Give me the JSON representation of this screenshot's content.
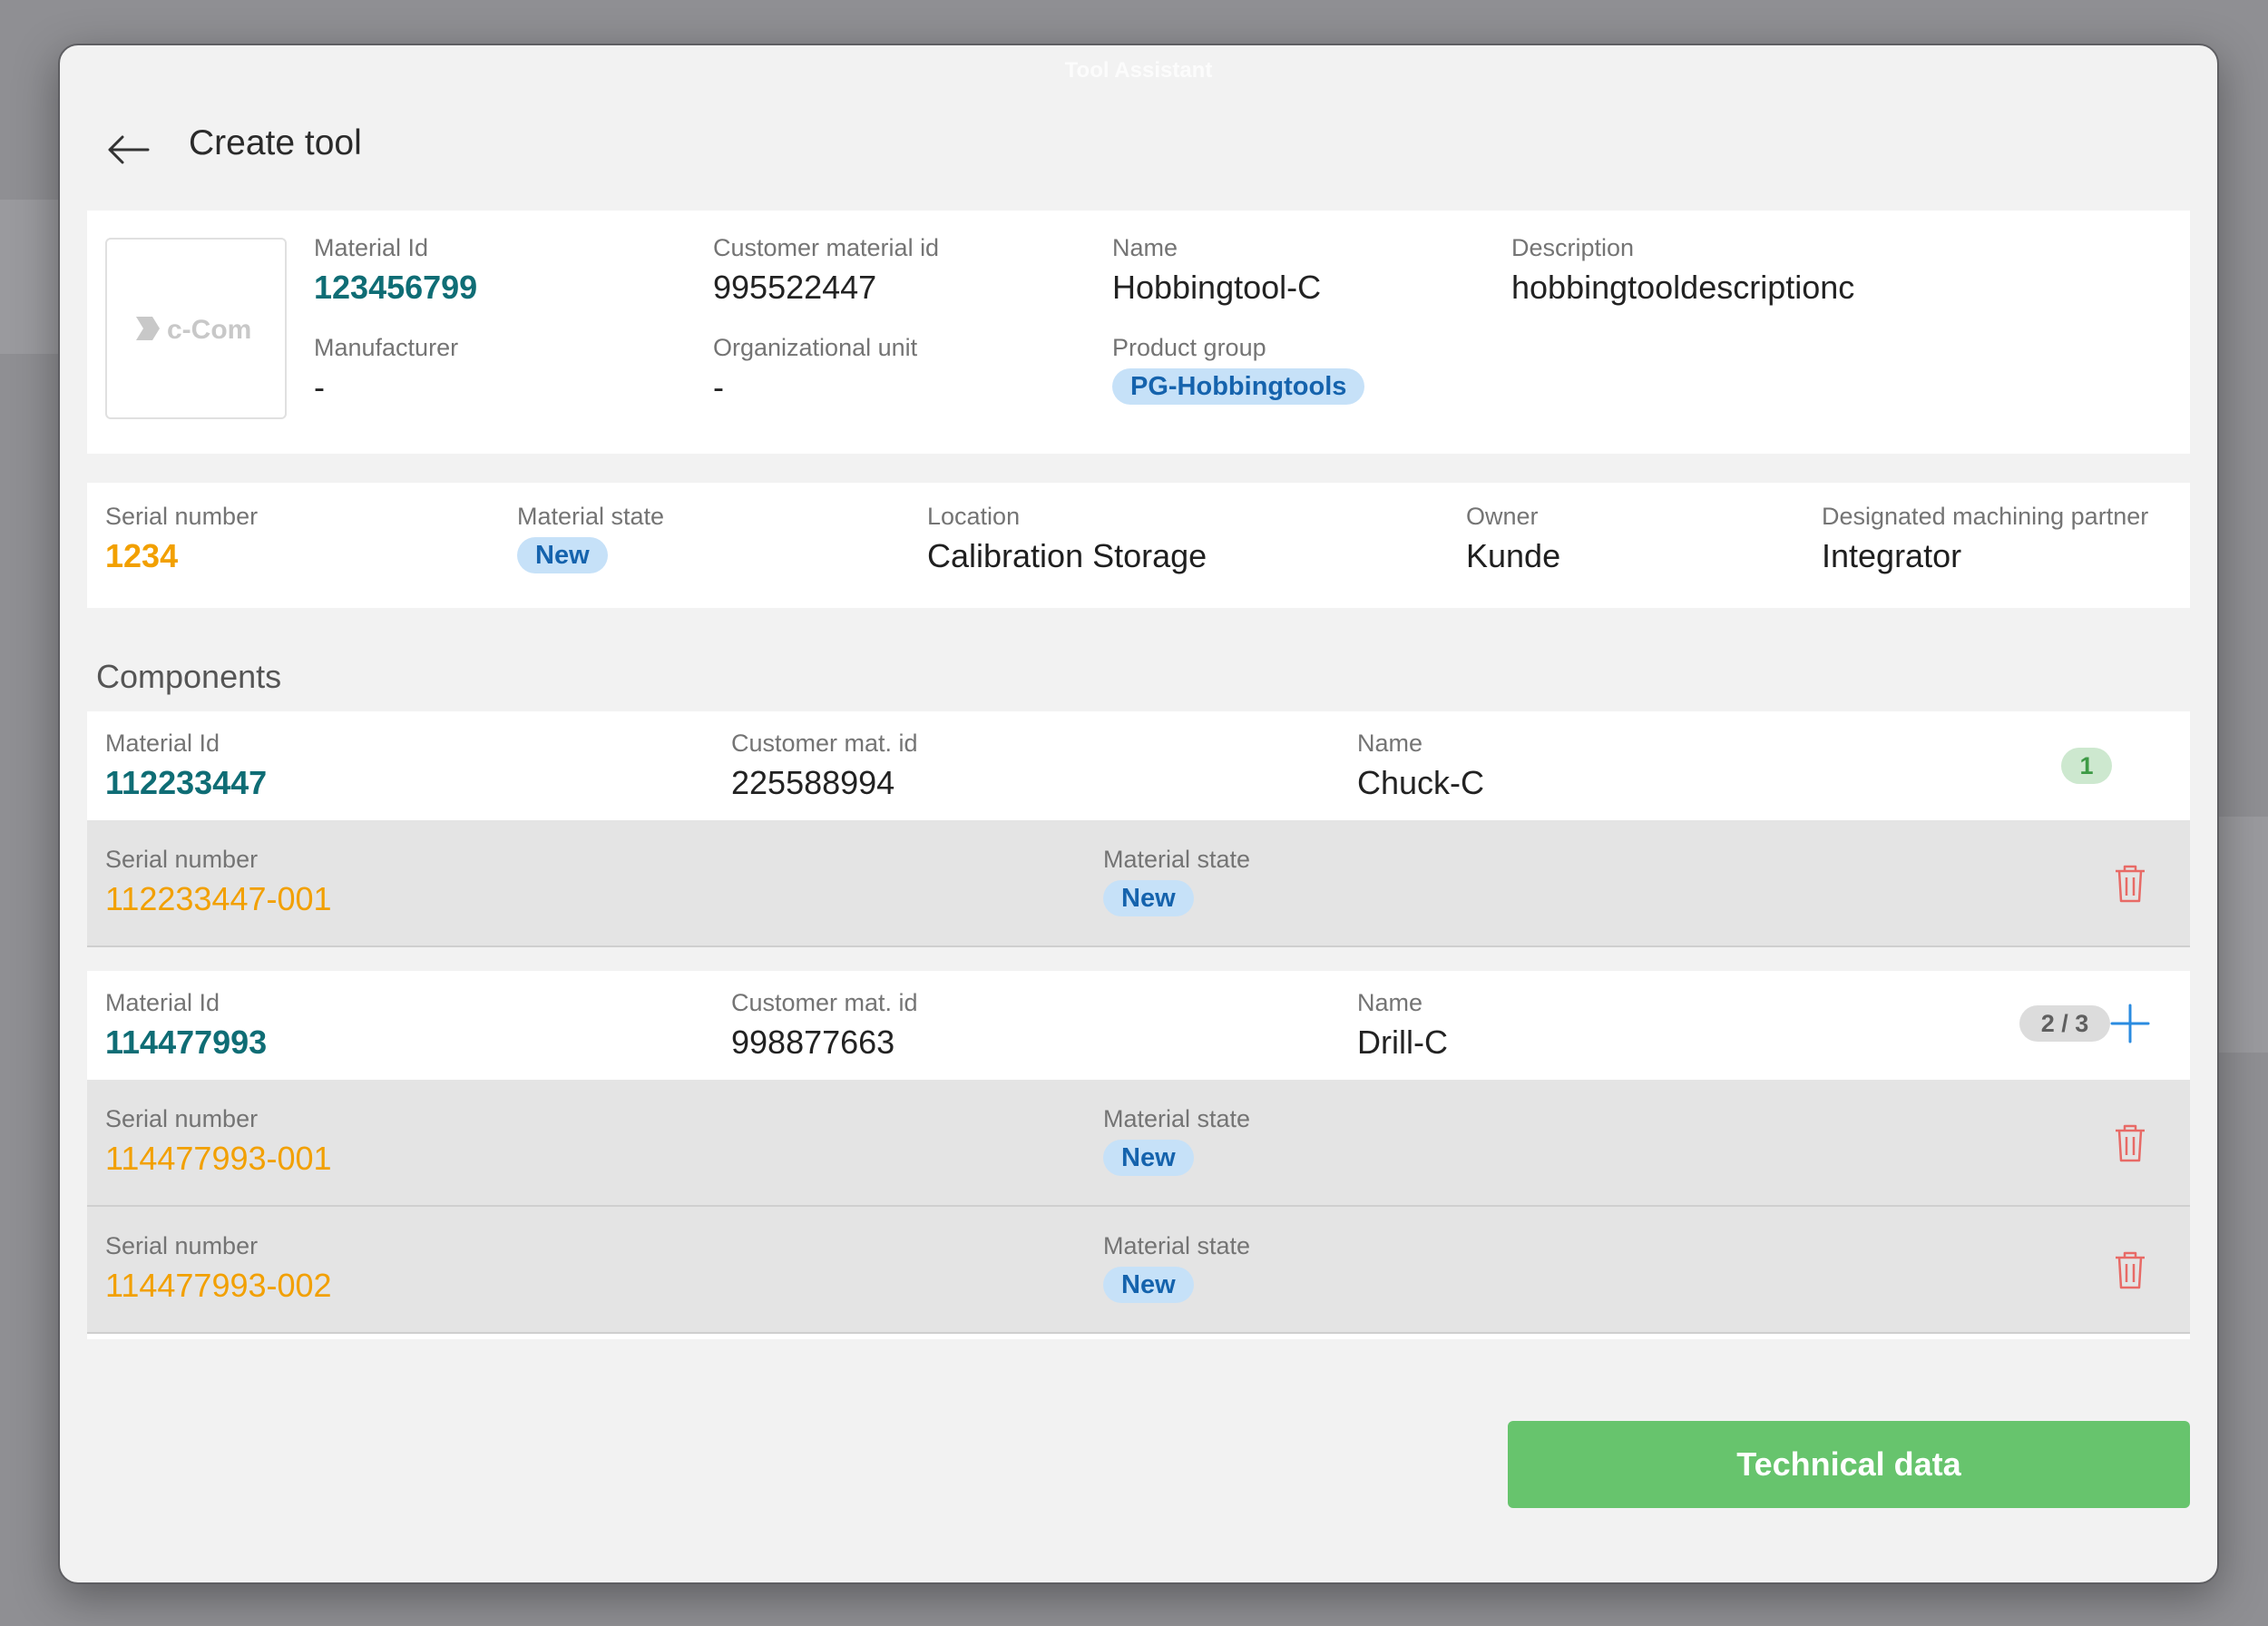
{
  "window": {
    "title": "Tool Assistant"
  },
  "header": {
    "title": "Create tool"
  },
  "tool": {
    "logo_text": "c-Com",
    "material_id": {
      "label": "Material Id",
      "value": "123456799"
    },
    "customer_material_id": {
      "label": "Customer material id",
      "value": "995522447"
    },
    "name": {
      "label": "Name",
      "value": "Hobbingtool-C"
    },
    "description": {
      "label": "Description",
      "value": "hobbingtooldescriptionc"
    },
    "manufacturer": {
      "label": "Manufacturer",
      "value": "-"
    },
    "organizational_unit": {
      "label": "Organizational unit",
      "value": "-"
    },
    "product_group": {
      "label": "Product group",
      "value": "PG-Hobbingtools"
    }
  },
  "instance": {
    "serial_number": {
      "label": "Serial number",
      "value": "1234"
    },
    "material_state": {
      "label": "Material state",
      "value": "New"
    },
    "location": {
      "label": "Location",
      "value": "Calibration Storage"
    },
    "owner": {
      "label": "Owner",
      "value": "Kunde"
    },
    "partner": {
      "label": "Designated machining partner",
      "value": "Integrator"
    }
  },
  "components": {
    "title": "Components",
    "items": [
      {
        "material_id_label": "Material Id",
        "material_id": "112233447",
        "customer_id_label": "Customer mat. id",
        "customer_id": "225588994",
        "name_label": "Name",
        "name": "Chuck-C",
        "count": "1",
        "serials": [
          {
            "serial_label": "Serial number",
            "serial": "112233447-001",
            "state_label": "Material state",
            "state": "New"
          }
        ]
      },
      {
        "material_id_label": "Material Id",
        "material_id": "114477993",
        "customer_id_label": "Customer mat. id",
        "customer_id": "998877663",
        "name_label": "Name",
        "name": "Drill-C",
        "count": "2 / 3",
        "serials": [
          {
            "serial_label": "Serial number",
            "serial": "114477993-001",
            "state_label": "Material state",
            "state": "New"
          },
          {
            "serial_label": "Serial number",
            "serial": "114477993-002",
            "state_label": "Material state",
            "state": "New"
          }
        ]
      }
    ]
  },
  "actions": {
    "technical_data": "Technical data"
  },
  "colors": {
    "accent_teal": "#0f6d75",
    "serial_orange": "#f2a000",
    "chip_blue": "#1563ad",
    "button_green": "#67c46d",
    "delete_red": "#e86a66",
    "add_blue": "#2a8be0"
  },
  "icons": [
    "arrow-left-icon",
    "trash-icon",
    "plus-icon",
    "c-com-logo"
  ]
}
